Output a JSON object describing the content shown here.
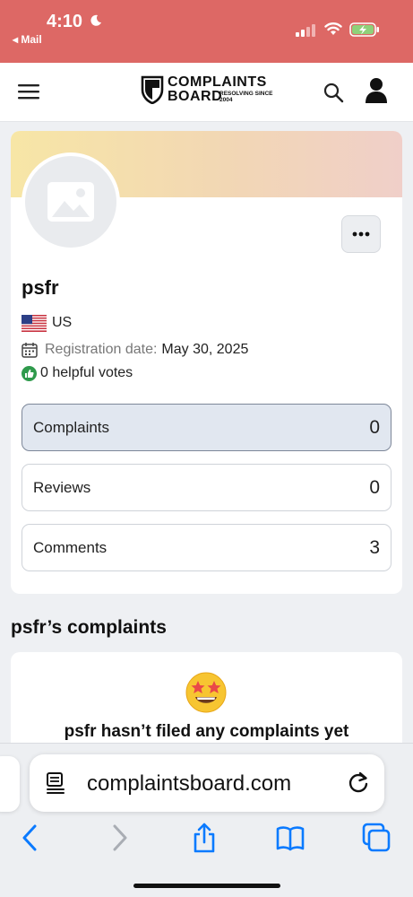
{
  "status_bar": {
    "time": "4:10",
    "back_label": "◂ Mail"
  },
  "header": {
    "logo_line1": "COMPLAINTS",
    "logo_line2": "BOARD",
    "logo_tagline": "RESOLVING SINCE 2004",
    "icons": [
      "menu-icon",
      "search-icon",
      "user-icon"
    ]
  },
  "profile": {
    "username": "psfr",
    "country": "US",
    "registration_label": "Registration date:",
    "registration_date": "May 30, 2025",
    "helpful_votes": "0 helpful votes",
    "stats": [
      {
        "label": "Complaints",
        "count": "0",
        "active": true
      },
      {
        "label": "Reviews",
        "count": "0",
        "active": false
      },
      {
        "label": "Comments",
        "count": "3",
        "active": false
      }
    ]
  },
  "complaints_section": {
    "title": "psfr’s complaints",
    "empty_message": "psfr hasn’t filed any complaints yet"
  },
  "browser": {
    "url": "complaintsboard.com",
    "toolbar_icons": [
      "back-icon",
      "forward-icon",
      "share-icon",
      "bookmarks-icon",
      "tabs-icon"
    ]
  },
  "colors": {
    "status_bar_bg": "#dd6865",
    "accent_blue": "#0a7aff",
    "active_tab_bg": "#e1e7f0"
  }
}
